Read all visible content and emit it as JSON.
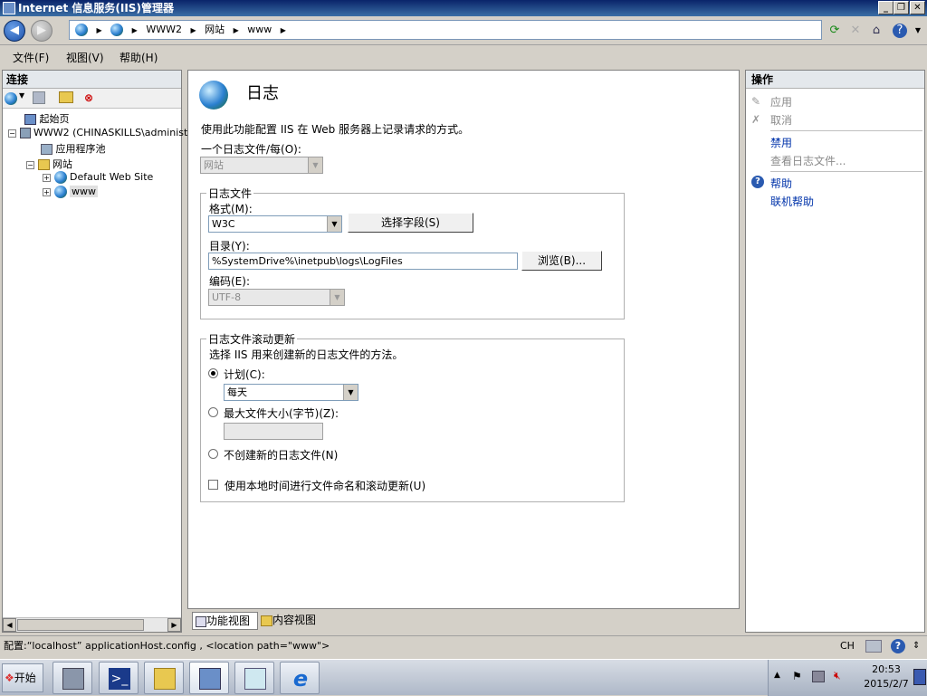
{
  "window": {
    "title": "Internet 信息服务(IIS)管理器"
  },
  "address": {
    "crumbs": [
      "WWW2",
      "网站",
      "www"
    ]
  },
  "menu": {
    "file": "文件(F)",
    "view": "视图(V)",
    "help": "帮助(H)"
  },
  "connections": {
    "header": "连接",
    "tree": {
      "start": "起始页",
      "server": "WWW2 (CHINASKILLS\\administ",
      "apppools": "应用程序池",
      "sites": "网站",
      "default_site": "Default Web Site",
      "www": "www"
    }
  },
  "page": {
    "title": "日志",
    "description": "使用此功能配置 IIS 在 Web 服务器上记录请求的方式。",
    "one_log_label": "一个日志文件/每(O):",
    "one_log_value": "网站",
    "logfile": {
      "legend": "日志文件",
      "format_label": "格式(M):",
      "format_value": "W3C",
      "select_fields": "选择字段(S)",
      "dir_label": "目录(Y):",
      "dir_value": "%SystemDrive%\\inetpub\\logs\\LogFiles",
      "browse": "浏览(B)...",
      "encoding_label": "编码(E):",
      "encoding_value": "UTF-8"
    },
    "rollover": {
      "legend": "日志文件滚动更新",
      "desc": "选择 IIS 用来创建新的日志文件的方法。",
      "schedule_label": "计划(C):",
      "schedule_value": "每天",
      "maxsize_label": "最大文件大小(字节)(Z):",
      "no_new_label": "不创建新的日志文件(N)",
      "local_time_label": "使用本地时间进行文件命名和滚动更新(U)"
    }
  },
  "bottom_tabs": {
    "feature": "功能视图",
    "content": "内容视图"
  },
  "actions": {
    "header": "操作",
    "apply": "应用",
    "cancel": "取消",
    "disable": "禁用",
    "view_logs": "查看日志文件...",
    "help": "帮助",
    "online_help": "联机帮助"
  },
  "status": {
    "text": "配置:“localhost” applicationHost.config , <location path=\"www\">",
    "lang": "CH"
  },
  "taskbar": {
    "start": "开始",
    "time": "20:53",
    "date": "2015/2/7"
  },
  "colors": {
    "link": "#0033aa",
    "disabled": "#8a8a8a",
    "title_bg": "#0a246a"
  }
}
